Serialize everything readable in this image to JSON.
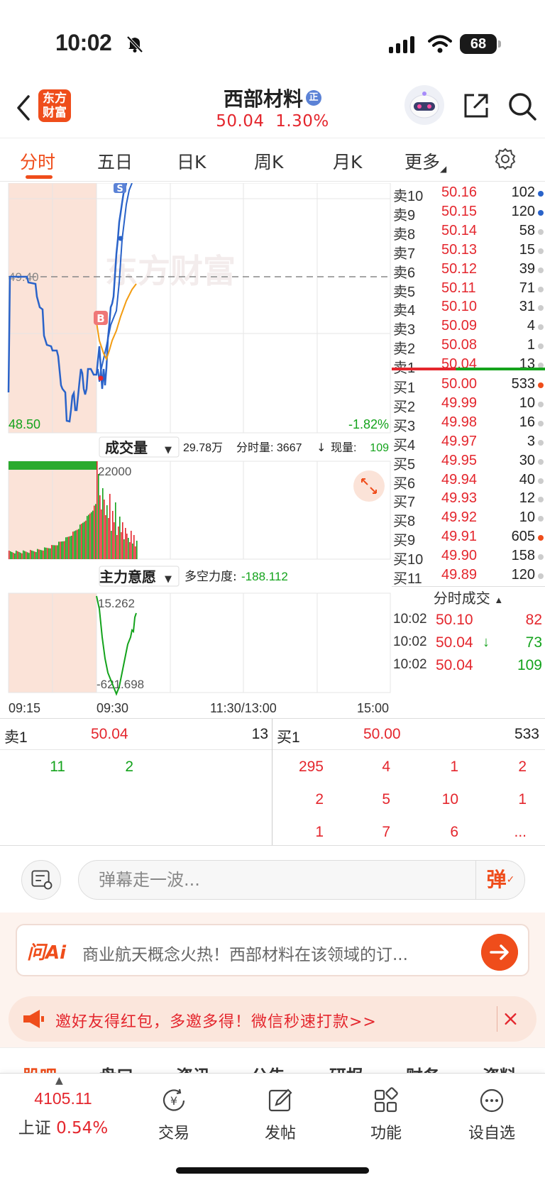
{
  "status_bar": {
    "time": "10:02",
    "battery": "68"
  },
  "header": {
    "logo": "东方\n财富",
    "stock_name": "西部材料",
    "badge": "正",
    "price": "50.04",
    "change_pct": "1.30%"
  },
  "tabs": [
    {
      "label": "分时",
      "active": true
    },
    {
      "label": "五日"
    },
    {
      "label": "日K"
    },
    {
      "label": "周K"
    },
    {
      "label": "月K"
    },
    {
      "label": "更多"
    }
  ],
  "chart": {
    "watermark": "东方财富",
    "price_high_label": "49.40",
    "price_low_label": "48.50",
    "pct_low_label": "-1.82%",
    "buy_marker": "B",
    "sell_marker": "S",
    "volume_selector": "成交量",
    "volume_info_total": "29.78万",
    "volume_info_minute": "分时量: 3667",
    "volume_info_now": "现量:",
    "volume_info_now_val": "109",
    "volume_scale": "22000",
    "force_selector": "主力意愿",
    "force_label": "多空力度:",
    "force_value": "-188.112",
    "force_high": "15.262",
    "force_low": "-621.698",
    "time_labels": [
      "09:15",
      "09:30",
      "11:30/13:00",
      "15:00"
    ]
  },
  "orderbook": {
    "asks": [
      {
        "label": "卖10",
        "price": "50.16",
        "vol": "102",
        "dot": "#2a63c9"
      },
      {
        "label": "卖9",
        "price": "50.15",
        "vol": "120",
        "dot": "#2a63c9"
      },
      {
        "label": "卖8",
        "price": "50.14",
        "vol": "58",
        "dot": "#cccccc"
      },
      {
        "label": "卖7",
        "price": "50.13",
        "vol": "15",
        "dot": "#cccccc"
      },
      {
        "label": "卖6",
        "price": "50.12",
        "vol": "39",
        "dot": "#cccccc"
      },
      {
        "label": "卖5",
        "price": "50.11",
        "vol": "71",
        "dot": "#cccccc"
      },
      {
        "label": "卖4",
        "price": "50.10",
        "vol": "31",
        "dot": "#cccccc"
      },
      {
        "label": "卖3",
        "price": "50.09",
        "vol": "4",
        "dot": "#cccccc"
      },
      {
        "label": "卖2",
        "price": "50.08",
        "vol": "1",
        "dot": "#cccccc"
      },
      {
        "label": "卖1",
        "price": "50.04",
        "vol": "13",
        "dot": "#cccccc"
      }
    ],
    "bids": [
      {
        "label": "买1",
        "price": "50.00",
        "vol": "533",
        "dot": "#ef4d1b"
      },
      {
        "label": "买2",
        "price": "49.99",
        "vol": "10",
        "dot": "#cccccc"
      },
      {
        "label": "买3",
        "price": "49.98",
        "vol": "16",
        "dot": "#cccccc"
      },
      {
        "label": "买4",
        "price": "49.97",
        "vol": "3",
        "dot": "#cccccc"
      },
      {
        "label": "买5",
        "price": "49.95",
        "vol": "30",
        "dot": "#cccccc"
      },
      {
        "label": "买6",
        "price": "49.94",
        "vol": "40",
        "dot": "#cccccc"
      },
      {
        "label": "买7",
        "price": "49.93",
        "vol": "12",
        "dot": "#cccccc"
      },
      {
        "label": "买8",
        "price": "49.92",
        "vol": "10",
        "dot": "#cccccc"
      },
      {
        "label": "买9",
        "price": "49.91",
        "vol": "605",
        "dot": "#ef4d1b"
      },
      {
        "label": "买10",
        "price": "49.90",
        "vol": "158",
        "dot": "#cccccc"
      },
      {
        "label": "买11",
        "price": "49.89",
        "vol": "120",
        "dot": "#cccccc"
      }
    ],
    "trades_title": "分时成交",
    "trades": [
      {
        "time": "10:02",
        "price": "50.10",
        "arrow": "",
        "vol": "82",
        "color": "red"
      },
      {
        "time": "10:02",
        "price": "50.04",
        "arrow": "↓",
        "vol": "73",
        "color": "green"
      },
      {
        "time": "10:02",
        "price": "50.04",
        "arrow": "",
        "vol": "109",
        "color": "green"
      }
    ]
  },
  "depth": {
    "ask_label": "卖1",
    "ask_price": "50.04",
    "ask_vol": "13",
    "bid_label": "买1",
    "bid_price": "50.00",
    "bid_vol": "533",
    "ask_queue": [
      "11",
      "2"
    ],
    "bid_queue": [
      "295",
      "4",
      "1",
      "2",
      "2",
      "5",
      "10",
      "1",
      "1",
      "7",
      "6",
      "..."
    ]
  },
  "danmu": {
    "placeholder": "弹幕走一波...",
    "send_label": "弹"
  },
  "ai": {
    "logo": "问Ai",
    "text": "商业航天概念火热！西部材料在该领域的订..."
  },
  "promo": {
    "text": "邀好友得红包，多邀多得！微信秒速打款>>"
  },
  "section_tabs": [
    "股吧",
    "盘口",
    "资讯",
    "公告",
    "研报",
    "财务",
    "资料"
  ],
  "bottom_nav": {
    "index_value": "4105.11",
    "index_name": "上证",
    "index_change": "0.54%",
    "items": [
      "交易",
      "发帖",
      "功能",
      "设自选"
    ]
  },
  "colors": {
    "accent": "#ef4d1b",
    "up": "#e4262d",
    "down": "#14a31c",
    "price_line": "#2a63c9",
    "avg_line": "#f39c12"
  },
  "chart_data": {
    "type": "line",
    "title": "",
    "ylim": [
      48.5,
      49.9
    ],
    "reference_price": 49.4,
    "price_line": [
      {
        "t": "09:15",
        "p": 49.4
      },
      {
        "t": "09:17",
        "p": 49.4
      },
      {
        "t": "09:19",
        "p": 49.38
      },
      {
        "t": "09:21",
        "p": 49.3
      },
      {
        "t": "09:22",
        "p": 49.15
      },
      {
        "t": "09:23",
        "p": 49.1
      },
      {
        "t": "09:24",
        "p": 48.96
      },
      {
        "t": "09:25",
        "p": 48.93
      },
      {
        "t": "09:26",
        "p": 48.7
      },
      {
        "t": "09:27",
        "p": 48.52
      },
      {
        "t": "09:27.5",
        "p": 48.78
      },
      {
        "t": "09:28",
        "p": 48.6
      },
      {
        "t": "09:28.5",
        "p": 48.8
      },
      {
        "t": "09:29",
        "p": 48.85
      },
      {
        "t": "09:30",
        "p": 48.82
      },
      {
        "t": "09:31",
        "p": 48.7
      },
      {
        "t": "09:32",
        "p": 48.9
      },
      {
        "t": "09:33",
        "p": 49.05
      },
      {
        "t": "09:34",
        "p": 49.1
      },
      {
        "t": "09:35",
        "p": 49.55
      },
      {
        "t": "09:36",
        "p": 49.7
      },
      {
        "t": "09:37",
        "p": 49.9
      }
    ],
    "avg_line": [
      {
        "t": "09:30",
        "p": 48.87
      },
      {
        "t": "09:32",
        "p": 48.95
      },
      {
        "t": "09:34",
        "p": 49.05
      },
      {
        "t": "09:36",
        "p": 49.15
      },
      {
        "t": "09:38",
        "p": 49.25
      }
    ],
    "volume_bars_color_pattern": "mixed red/green, rising toward 09:30",
    "force_line": [
      {
        "t": "09:30",
        "v": 15.262
      },
      {
        "t": "09:31",
        "v": -300
      },
      {
        "t": "09:32",
        "v": -621.698
      },
      {
        "t": "09:33",
        "v": -450
      },
      {
        "t": "09:34",
        "v": -200
      },
      {
        "t": "09:35",
        "v": -188.112
      }
    ]
  }
}
